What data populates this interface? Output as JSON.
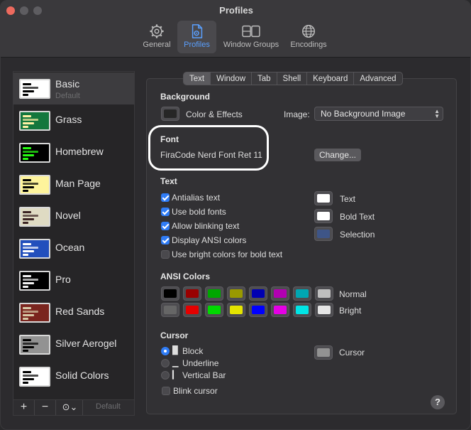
{
  "window": {
    "title": "Profiles"
  },
  "toolbar": [
    {
      "label": "General",
      "icon": "gear-icon"
    },
    {
      "label": "Profiles",
      "icon": "profile-doc-icon",
      "active": true
    },
    {
      "label": "Window Groups",
      "icon": "window-groups-icon"
    },
    {
      "label": "Encodings",
      "icon": "globe-icon"
    }
  ],
  "profiles": [
    {
      "name": "Basic",
      "sub": "Default",
      "bg": "#ffffff",
      "fg": "#000000",
      "selected": true
    },
    {
      "name": "Grass",
      "sub": "",
      "bg": "#13773d",
      "fg": "#fff0a5"
    },
    {
      "name": "Homebrew",
      "sub": "",
      "bg": "#000000",
      "fg": "#28fe14"
    },
    {
      "name": "Man Page",
      "sub": "",
      "bg": "#fef49c",
      "fg": "#000000"
    },
    {
      "name": "Novel",
      "sub": "",
      "bg": "#dfdbc3",
      "fg": "#3b2322"
    },
    {
      "name": "Ocean",
      "sub": "",
      "bg": "#224fbc",
      "fg": "#ffffff"
    },
    {
      "name": "Pro",
      "sub": "",
      "bg": "#000000",
      "fg": "#f2f2f2"
    },
    {
      "name": "Red Sands",
      "sub": "",
      "bg": "#7a251e",
      "fg": "#d7c9a7"
    },
    {
      "name": "Silver Aerogel",
      "sub": "",
      "bg": "#929292",
      "fg": "#000000"
    },
    {
      "name": "Solid Colors",
      "sub": "",
      "bg": "#ffffff",
      "fg": "#000000"
    }
  ],
  "sidebar_footer": {
    "add": "+",
    "remove": "−",
    "more": "⊙⌄",
    "default_label": "Default"
  },
  "tabs": [
    {
      "label": "Text",
      "active": true
    },
    {
      "label": "Window"
    },
    {
      "label": "Tab"
    },
    {
      "label": "Shell"
    },
    {
      "label": "Keyboard"
    },
    {
      "label": "Advanced"
    }
  ],
  "background": {
    "heading": "Background",
    "color_effects_label": "Color & Effects",
    "color": "#262626",
    "image_label": "Image:",
    "image_value": "No Background Image"
  },
  "font": {
    "heading": "Font",
    "value": "FiraCode Nerd Font Ret 11",
    "change_label": "Change..."
  },
  "text": {
    "heading": "Text",
    "options": [
      {
        "label": "Antialias text",
        "checked": true
      },
      {
        "label": "Use bold fonts",
        "checked": true
      },
      {
        "label": "Allow blinking text",
        "checked": true
      },
      {
        "label": "Display ANSI colors",
        "checked": true
      },
      {
        "label": "Use bright colors for bold text",
        "checked": false
      }
    ],
    "colors": [
      {
        "label": "Text",
        "color": "#ffffff"
      },
      {
        "label": "Bold Text",
        "color": "#ffffff"
      },
      {
        "label": "Selection",
        "color": "#3e5587"
      }
    ]
  },
  "ansi": {
    "heading": "ANSI Colors",
    "normal_label": "Normal",
    "bright_label": "Bright",
    "normal": [
      "#000000",
      "#990000",
      "#00a600",
      "#999900",
      "#0000b2",
      "#b200b2",
      "#00a6b2",
      "#bfbfbf"
    ],
    "bright": [
      "#666666",
      "#e50000",
      "#00d900",
      "#e5e500",
      "#0000ff",
      "#e500e5",
      "#00e5e5",
      "#e5e5e5"
    ]
  },
  "cursor": {
    "heading": "Cursor",
    "options": [
      {
        "label": "Block",
        "glyph": "█",
        "selected": true
      },
      {
        "label": "Underline",
        "glyph": "▁",
        "selected": false
      },
      {
        "label": "Vertical Bar",
        "glyph": "▎",
        "selected": false
      }
    ],
    "blink_label": "Blink cursor",
    "blink": false,
    "color_label": "Cursor",
    "color": "#929292"
  },
  "help": "?"
}
